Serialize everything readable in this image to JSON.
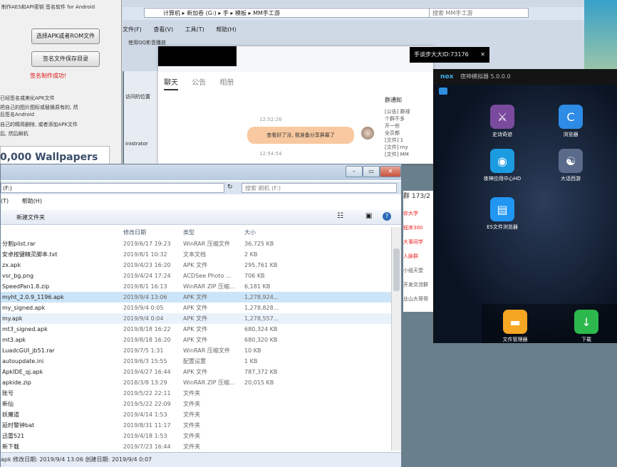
{
  "signer": {
    "title": "制作AES和API密钥 签名软件 for Android",
    "btn_select": "选择APK或者ROM文件",
    "btn_save": "签名文件保存目录",
    "status": "签名制作成功!",
    "notes": [
      "已经签名或美化APK文件",
      "把自己的图片图标或替换原有的, 然",
      "后签名Android",
      "自己的精简删除, 或者添加APK文件",
      "后, 然后刷机"
    ],
    "ad": "0,000 Wallpapers"
  },
  "explorer_back": {
    "path": "计算机 ▸ 新加卷 (G:) ▸ 手 ▸ 模板 ▸ MM手工游",
    "search": "搜索 MM手工游",
    "menu": [
      "文件(F)",
      "查看(V)",
      "工具(T)",
      "帮助(H)"
    ],
    "toolbar": "使用QQ影音播放",
    "sidebar_text": [
      "访问的位置",
      "inistrator"
    ]
  },
  "qq": {
    "tabs": [
      "聊天",
      "公告",
      "相册"
    ],
    "id_bar": "手谈步大大ID:73176",
    "time1": "12:52:26",
    "bubble": "查看好了没, 我准备分享屏幕了",
    "time2": "12:54:54",
    "side_title": "群通知",
    "side_lines": [
      "[公告] 群规",
      "个群不多",
      "开一些",
      "全员都",
      "[文件] 1",
      "[文件] my",
      "[文件] MM"
    ],
    "side_count": "群 173/2",
    "side_red": [
      "你大学",
      "程序300",
      "大事同学",
      "人脉群"
    ],
    "side_more": [
      "小组天堂",
      "开发交流群",
      "业山大哥哥"
    ]
  },
  "nox": {
    "title": "夜神模拟器 5.0.0.0",
    "apps": [
      {
        "label": "史诗奇迹",
        "icon": "game-icon",
        "color": "#7a4a9e",
        "glyph": "⚔"
      },
      {
        "label": "浏览器",
        "icon": "browser-icon",
        "color": "#2e8be6",
        "glyph": "C"
      },
      {
        "label": "夜神应用中心HD",
        "icon": "app-center-icon",
        "color": "#1c9be0",
        "glyph": "◉"
      },
      {
        "label": "大话西游",
        "icon": "game2-icon",
        "color": "#5a6a8a",
        "glyph": "☯"
      },
      {
        "label": "ES文件浏览器",
        "icon": "es-file-icon",
        "color": "#2196f3",
        "glyph": "▤"
      }
    ],
    "dock": [
      {
        "label": "文件管理器",
        "icon": "folder-icon",
        "color": "#f5a623",
        "glyph": "▬"
      },
      {
        "label": "下载",
        "icon": "download-icon",
        "color": "#2db84d",
        "glyph": "↓"
      }
    ]
  },
  "explorer": {
    "path": "(F:)",
    "search": "搜索 刷机 (F:)",
    "menu": [
      "(T)",
      "帮助(H)"
    ],
    "new_folder": "新建文件夹",
    "columns": [
      "修改日期",
      "类型",
      "大小"
    ],
    "files": [
      {
        "name": "分割plist.rar",
        "date": "2019/6/17 19:23",
        "type": "WinRAR 压缩文件",
        "size": "36,725 KB"
      },
      {
        "name": "安卓按键精灵脚本.txt",
        "date": "2019/8/1 10:32",
        "type": "文本文档",
        "size": "2 KB"
      },
      {
        "name": "zx.apk",
        "date": "2019/4/23 16:20",
        "type": "APK 文件",
        "size": "295,761 KB"
      },
      {
        "name": "vsr_bg.png",
        "date": "2019/4/24 17:24",
        "type": "ACDSee Photo ...",
        "size": "706 KB"
      },
      {
        "name": "SpeedPan1.8.zip",
        "date": "2019/8/1 16:13",
        "type": "WinRAR ZIP 压缩...",
        "size": "6,181 KB"
      },
      {
        "name": "myht_2.0.9_1196.apk",
        "date": "2019/9/4 13:06",
        "type": "APK 文件",
        "size": "1,278,924..."
      },
      {
        "name": "my_signed.apk",
        "date": "2019/9/4 0:05",
        "type": "APK 文件",
        "size": "1,278,828..."
      },
      {
        "name": "my.apk",
        "date": "2019/9/4 0:04",
        "type": "APK 文件",
        "size": "1,278,557..."
      },
      {
        "name": "mt3_signed.apk",
        "date": "2019/8/18 16:22",
        "type": "APK 文件",
        "size": "680,324 KB"
      },
      {
        "name": "mt3.apk",
        "date": "2019/8/18 16:20",
        "type": "APK 文件",
        "size": "680,320 KB"
      },
      {
        "name": "LuadcGUI_jb51.rar",
        "date": "2019/7/5 1:31",
        "type": "WinRAR 压缩文件",
        "size": "10 KB"
      },
      {
        "name": "autoupdate.ini",
        "date": "2019/6/3 15:55",
        "type": "配置设置",
        "size": "1 KB"
      },
      {
        "name": "ApkIDE_qj.apk",
        "date": "2019/4/27 16:44",
        "type": "APK 文件",
        "size": "787,372 KB"
      },
      {
        "name": "apkide.zip",
        "date": "2018/3/8 13:29",
        "type": "WinRAR ZIP 压缩...",
        "size": "20,015 KB"
      },
      {
        "name": "账号",
        "date": "2019/5/22 22:11",
        "type": "文件夹",
        "size": ""
      },
      {
        "name": "新仙",
        "date": "2019/5/22 22:09",
        "type": "文件夹",
        "size": ""
      },
      {
        "name": "妖魔道",
        "date": "2019/4/14 1:53",
        "type": "文件夹",
        "size": ""
      },
      {
        "name": "延时警钟bat",
        "date": "2019/8/31 11:17",
        "type": "文件夹",
        "size": ""
      },
      {
        "name": "迅雷521",
        "date": "2019/4/18 1:53",
        "type": "文件夹",
        "size": ""
      },
      {
        "name": "新下载",
        "date": "2019/7/23 16:44",
        "type": "文件夹",
        "size": ""
      }
    ],
    "status": "apk   修改日期: 2019/9/4 13:06   创建日期: 2019/9/4 0:07"
  }
}
